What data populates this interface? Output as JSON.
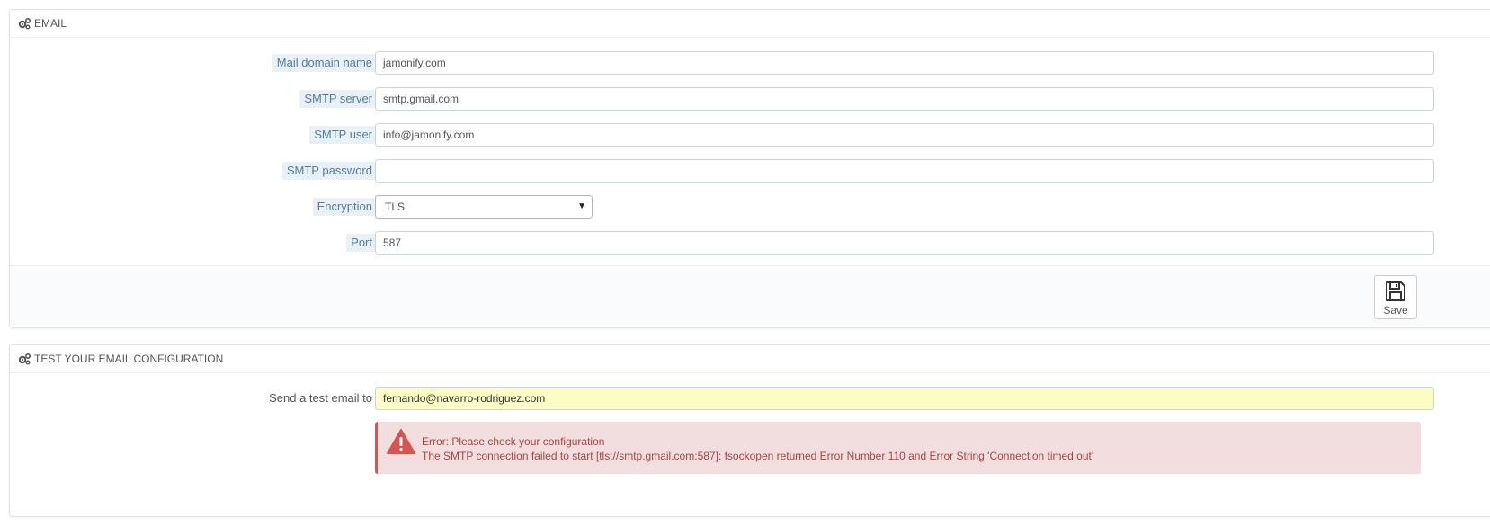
{
  "email_panel": {
    "title": "EMAIL",
    "fields": [
      {
        "label": "Mail domain name",
        "value": "jamonify.com"
      },
      {
        "label": "SMTP server",
        "value": "smtp.gmail.com"
      },
      {
        "label": "SMTP user",
        "value": "info@jamonify.com"
      },
      {
        "label": "SMTP password",
        "value": ""
      },
      {
        "label": "Encryption",
        "value": "TLS"
      },
      {
        "label": "Port",
        "value": "587"
      }
    ],
    "save_label": "Save"
  },
  "test_panel": {
    "title": "TEST YOUR EMAIL CONFIGURATION",
    "send_label": "Send a test email to",
    "send_value": "fernando@navarro-rodriguez.com",
    "error_title": "Error: Please check your configuration",
    "error_message": "The SMTP connection failed to start [tls://smtp.gmail.com:587]: fsockopen returned Error Number 110 and Error String 'Connection timed out'"
  },
  "icons": {
    "panel_heading": "cogs-icon",
    "save": "floppy-disk-icon",
    "error": "warning-triangle-icon"
  },
  "colors": {
    "label_text": "#4f7ea3",
    "label_bg": "#e8f1f8",
    "test_input_bg": "#fbfdc4",
    "alert_bg": "#f2dedf",
    "alert_text": "#a94442",
    "alert_icon": "#d9534f"
  }
}
